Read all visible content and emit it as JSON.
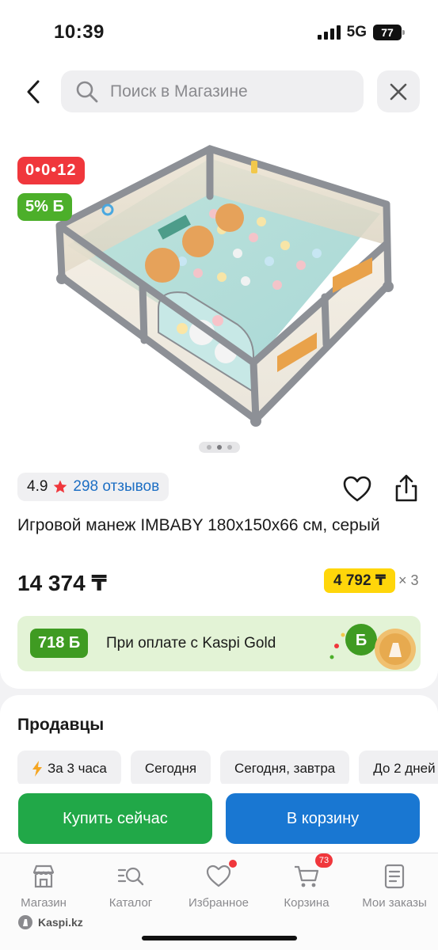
{
  "status_bar": {
    "time": "10:39",
    "network": "5G",
    "battery": "77"
  },
  "search": {
    "placeholder": "Поиск в Магазине"
  },
  "product": {
    "timer_badge": "0•0•12",
    "bonus_badge": "5% Б",
    "image_count": 3,
    "active_image": 1,
    "rating": "4.9",
    "reviews": "298 отзывов",
    "title": "Игровой манеж IMBABY 180x150x66 см, серый",
    "price": "14 374 ₸",
    "installment_price": "4 792 ₸",
    "installment_multiplier": "× 3"
  },
  "kaspi_gold": {
    "bonus": "718 Б",
    "text": "При оплате с Kaspi Gold"
  },
  "sellers": {
    "heading": "Продавцы",
    "chips": [
      {
        "label": "За 3 часа",
        "icon": "lightning-icon"
      },
      {
        "label": "Сегодня"
      },
      {
        "label": "Сегодня, завтра"
      },
      {
        "label": "До 2 дней"
      }
    ]
  },
  "actions": {
    "buy_now": "Купить сейчас",
    "add_to_cart": "В корзину"
  },
  "tabbar": {
    "items": [
      {
        "label": "Магазин",
        "icon": "shop-icon"
      },
      {
        "label": "Каталог",
        "icon": "catalog-search-icon"
      },
      {
        "label": "Избранное",
        "icon": "heart-icon"
      },
      {
        "label": "Корзина",
        "icon": "cart-icon",
        "badge": "73"
      },
      {
        "label": "Мои заказы",
        "icon": "orders-icon"
      }
    ]
  },
  "watermark": "Kaspi.kz",
  "colors": {
    "accent_green": "#21a848",
    "accent_blue": "#1977d2",
    "badge_red": "#f0373c",
    "installment_yellow": "#ffd60a"
  }
}
